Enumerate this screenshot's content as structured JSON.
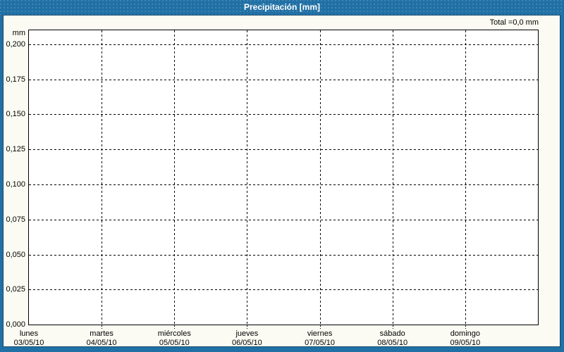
{
  "window": {
    "title": "Precipitación [mm]",
    "total_label": "Total =0,0 mm",
    "frame_color": "#2070A5",
    "frame_line_color": "#15486F"
  },
  "chart_data": {
    "type": "bar",
    "title": "Precipitación [mm]",
    "unit": "mm",
    "total": "0,0 mm",
    "grid": "dashed",
    "legend": "none",
    "categories": [
      {
        "day": "lunes",
        "date": "03/05/10"
      },
      {
        "day": "martes",
        "date": "04/05/10"
      },
      {
        "day": "miércoles",
        "date": "05/05/10"
      },
      {
        "day": "jueves",
        "date": "06/05/10"
      },
      {
        "day": "viernes",
        "date": "07/05/10"
      },
      {
        "day": "sábado",
        "date": "08/05/10"
      },
      {
        "day": "domingo",
        "date": "09/05/10"
      }
    ],
    "values": [
      0,
      0,
      0,
      0,
      0,
      0,
      0
    ],
    "y_axis": {
      "label": "mm",
      "range": [
        0,
        0.21
      ],
      "ticks": [
        {
          "label": "0,000",
          "value": 0.0
        },
        {
          "label": "0,025",
          "value": 0.025
        },
        {
          "label": "0,050",
          "value": 0.05
        },
        {
          "label": "0,075",
          "value": 0.075
        },
        {
          "label": "0,100",
          "value": 0.1
        },
        {
          "label": "0,125",
          "value": 0.125
        },
        {
          "label": "0,150",
          "value": 0.15
        },
        {
          "label": "0,175",
          "value": 0.175
        },
        {
          "label": "0,200",
          "value": 0.2
        }
      ]
    }
  }
}
